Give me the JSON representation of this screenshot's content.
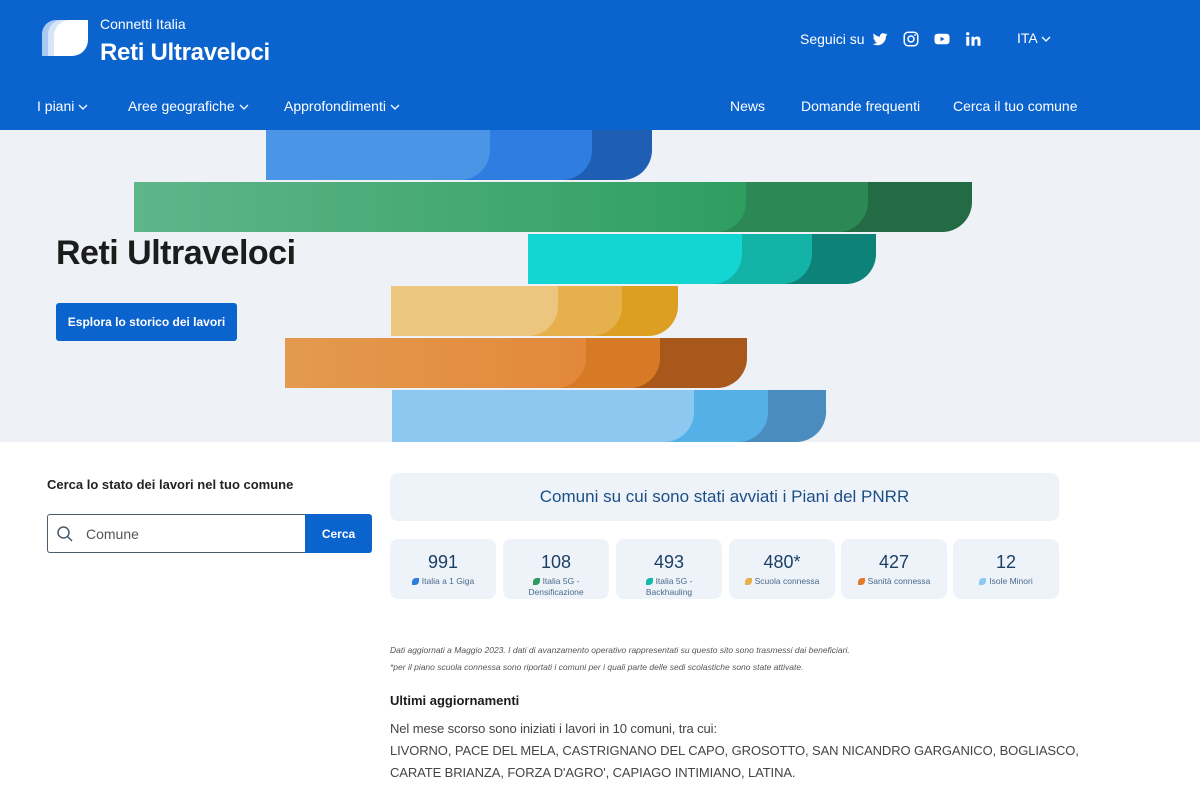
{
  "header": {
    "brand_small": "Connetti Italia",
    "brand_title": "Reti Ultraveloci",
    "social_label": "Seguici su",
    "social_icons": [
      "twitter-icon",
      "instagram-icon",
      "youtube-icon",
      "linkedin-icon"
    ],
    "language": "ITA",
    "nav_left": [
      "I piani",
      "Aree geografiche",
      "Approfondimenti"
    ],
    "nav_right": [
      "News",
      "Domande frequenti",
      "Cerca il tuo comune"
    ],
    "background_color": "#0b63ce"
  },
  "hero": {
    "title": "Reti Ultraveloci",
    "button_label": "Esplora lo storico dei lavori"
  },
  "search": {
    "label": "Cerca lo stato dei lavori nel tuo comune",
    "placeholder": "Comune",
    "button_label": "Cerca"
  },
  "stats": {
    "title": "Comuni su cui sono stati avviati i Piani del PNRR",
    "items": [
      {
        "value": "991",
        "label": "Italia a 1 Giga",
        "color": "#2f7de1"
      },
      {
        "value": "108",
        "label": "Italia 5G - Densificazione",
        "color": "#2e9b5e"
      },
      {
        "value": "493",
        "label": "Italia 5G - Backhauling",
        "color": "#14b8a6"
      },
      {
        "value": "480*",
        "label": "Scuola connessa",
        "color": "#e8b04a"
      },
      {
        "value": "427",
        "label": "Sanità connessa",
        "color": "#e07b2a"
      },
      {
        "value": "12",
        "label": "Isole Minori",
        "color": "#8cc8f0"
      }
    ]
  },
  "notes": {
    "line1": "Dati aggiornati a Maggio 2023. I dati di avanzamento operativo rappresentati su questo sito sono trasmessi dai beneficiari.",
    "line2": "*per il piano scuola connessa sono riportati i comuni per i quali parte delle sedi scolastiche sono state attivate."
  },
  "updates": {
    "title": "Ultimi aggiornamenti",
    "intro": "Nel mese scorso sono iniziati i lavori in 10 comuni, tra cui:",
    "line1": "LIVORNO, PACE DEL MELA, CASTRIGNANO DEL CAPO, GROSOTTO, SAN NICANDRO GARGANICO, BOGLIASCO,",
    "line2": "CARATE BRIANZA, FORZA D'AGRO', CAPIAGO INTIMIANO, LATINA."
  }
}
